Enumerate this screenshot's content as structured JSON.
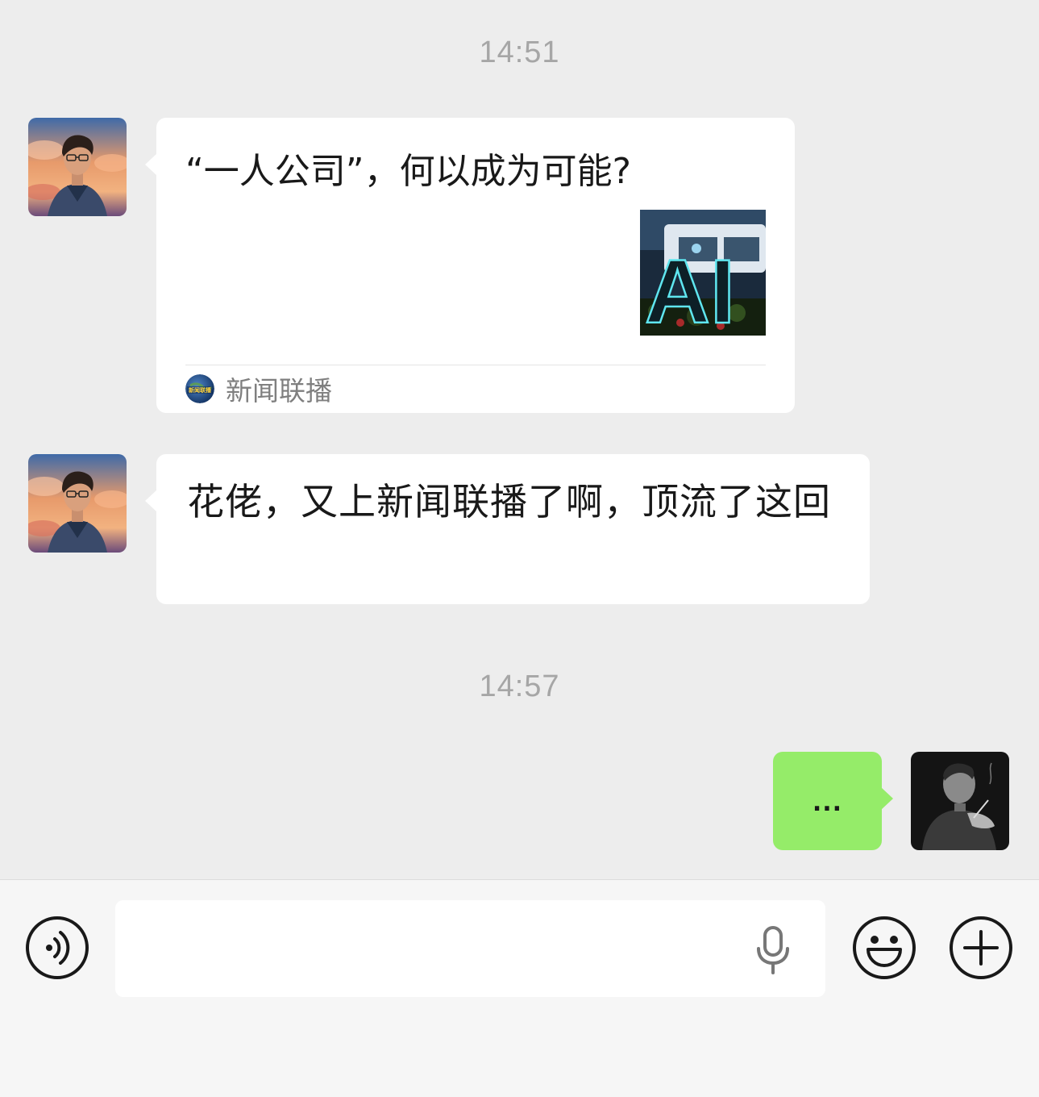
{
  "colors": {
    "background": "#ededed",
    "incoming_bubble": "#ffffff",
    "outgoing_bubble": "#95ec69",
    "timestamp": "#a6a6a6",
    "text": "#191919"
  },
  "messages": [
    {
      "type": "timestamp",
      "text": "14:51"
    },
    {
      "type": "link-card",
      "direction": "incoming",
      "title": "“一人公司”，何以成为可能?",
      "thumbnail_text": "AI",
      "source": {
        "icon": "news-channel-logo",
        "icon_text": "新闻联播",
        "name": "新闻联播"
      }
    },
    {
      "type": "text",
      "direction": "incoming",
      "text": "花佬，又上新闻联播了啊，顶流了这回"
    },
    {
      "type": "timestamp",
      "text": "14:57"
    },
    {
      "type": "text",
      "direction": "outgoing",
      "text": "..."
    }
  ],
  "input_bar": {
    "voice_button_icon": "voice-wave-icon",
    "input_value": "",
    "mic_icon": "microphone-icon",
    "emoji_button_icon": "smiley-icon",
    "more_button_icon": "plus-icon"
  }
}
